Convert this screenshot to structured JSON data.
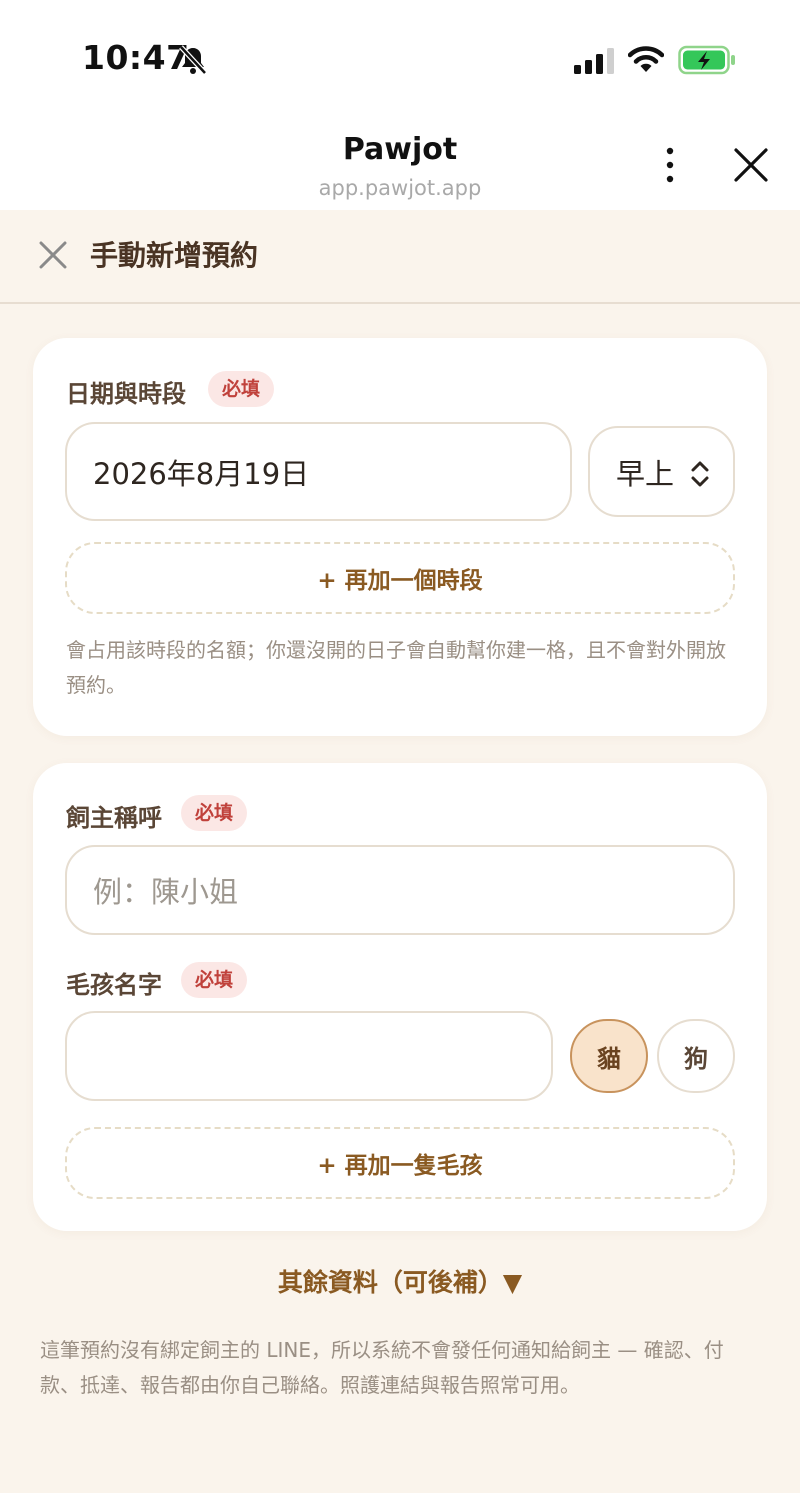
{
  "status_bar": {
    "time": "10:47"
  },
  "browser": {
    "title": "Pawjot",
    "url": "app.pawjot.app"
  },
  "header": {
    "title": "手動新增預約"
  },
  "schedule": {
    "label": "日期與時段",
    "required_badge": "必填",
    "date_value": "2026年8月19日",
    "period_value": "早上",
    "add_slot_label": "+ 再加一個時段",
    "note": "會占用該時段的名額；你還沒開的日子會自動幫你建一格，且不會對外開放預約。"
  },
  "owner": {
    "label": "飼主稱呼",
    "required_badge": "必填",
    "placeholder": "例：陳小姐"
  },
  "pet": {
    "label": "毛孩名字",
    "required_badge": "必填",
    "value": "",
    "species_options": [
      "貓",
      "狗"
    ],
    "selected_species": "貓",
    "add_pet_label": "+ 再加一隻毛孩"
  },
  "more_info_label": "其餘資料（可後補）▼",
  "footer_note": "這筆預約沒有綁定飼主的 LINE，所以系統不會發任何通知給飼主 — 確認、付款、抵達、報告都由你自己聯絡。照護連結與報告照常可用。",
  "colors": {
    "background": "#faf4ec",
    "accent": "#8a5a22",
    "required_badge_bg": "#fbe7e5",
    "required_badge_text": "#c0413b",
    "selected_chip_bg": "#f9e3cb"
  }
}
